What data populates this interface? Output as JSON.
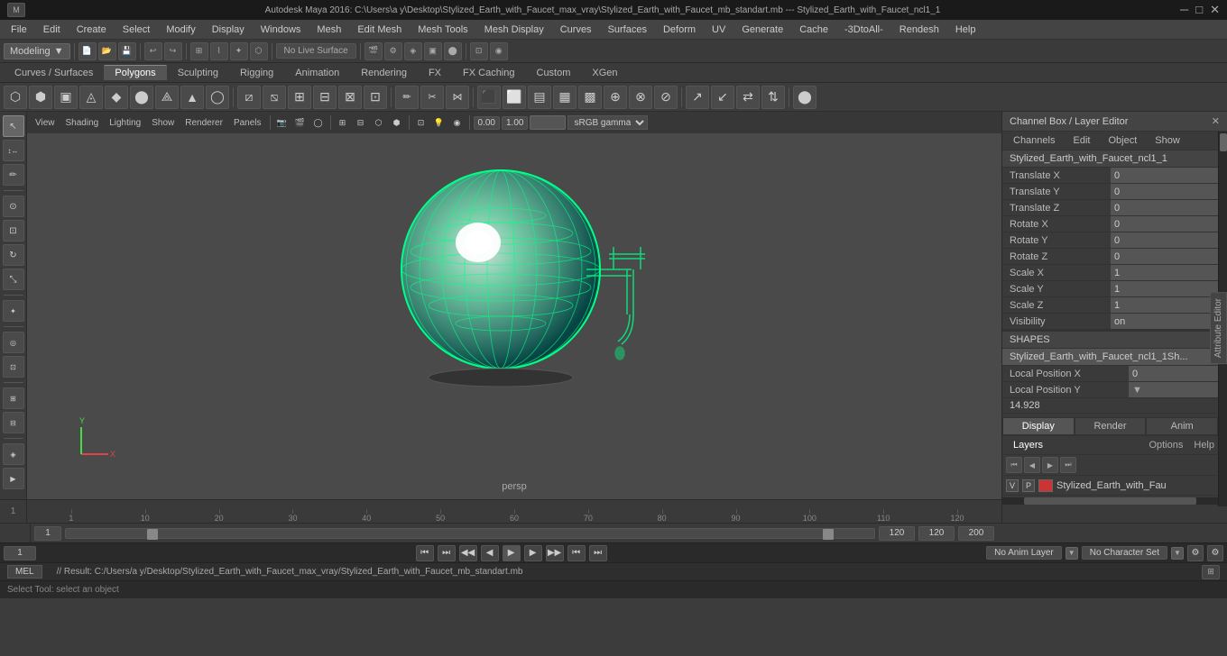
{
  "titlebar": {
    "title": "Autodesk Maya 2016: C:\\Users\\a y\\Desktop\\Stylized_Earth_with_Faucet_max_vray\\Stylized_Earth_with_Faucet_mb_standart.mb  ---  Stylized_Earth_with_Faucet_ncl1_1",
    "minimize": "─",
    "maximize": "□",
    "close": "✕"
  },
  "menubar": {
    "items": [
      "File",
      "Edit",
      "Create",
      "Select",
      "Modify",
      "Display",
      "Windows",
      "Mesh",
      "Edit Mesh",
      "Mesh Tools",
      "Mesh Display",
      "Curves",
      "Surfaces",
      "Deform",
      "UV",
      "Generate",
      "Cache",
      "-3DtoAll-",
      "Rendesh",
      "Help"
    ]
  },
  "workspace": {
    "selector": "Modeling",
    "no_live_surface": "No Live Surface"
  },
  "tabs": {
    "items": [
      "Curves / Surfaces",
      "Polygons",
      "Sculpting",
      "Rigging",
      "Animation",
      "Rendering",
      "FX",
      "FX Caching",
      "Custom",
      "XGen"
    ],
    "active": "Polygons"
  },
  "viewport": {
    "label": "persp",
    "toolbar_items": [
      "View",
      "Shading",
      "Lighting",
      "Show",
      "Renderer",
      "Panels"
    ]
  },
  "channel_box": {
    "header": "Channel Box / Layer Editor",
    "tabs": [
      "Channels",
      "Edit",
      "Object",
      "Show"
    ],
    "object_name": "Stylized_Earth_with_Faucet_ncl1_1",
    "attributes": [
      {
        "name": "Translate X",
        "value": "0"
      },
      {
        "name": "Translate Y",
        "value": "0"
      },
      {
        "name": "Translate Z",
        "value": "0"
      },
      {
        "name": "Rotate X",
        "value": "0"
      },
      {
        "name": "Rotate Y",
        "value": "0"
      },
      {
        "name": "Rotate Z",
        "value": "0"
      },
      {
        "name": "Scale X",
        "value": "1"
      },
      {
        "name": "Scale Y",
        "value": "1"
      },
      {
        "name": "Scale Z",
        "value": "1"
      },
      {
        "name": "Visibility",
        "value": "on"
      }
    ],
    "shapes_header": "SHAPES",
    "shapes_item": "Stylized_Earth_with_Faucet_ncl1_1Sh...",
    "shape_attributes": [
      {
        "name": "Local Position X",
        "value": "0"
      },
      {
        "name": "Local Position Y",
        "value": "14.928"
      }
    ]
  },
  "display_tabs": {
    "items": [
      "Display",
      "Render",
      "Anim"
    ],
    "active": "Display"
  },
  "layers": {
    "header": "Layers",
    "tabs": [
      "Layers",
      "Options",
      "Help"
    ],
    "active": "Layers",
    "toolbar_icons": [
      "<<",
      "<",
      ">",
      ">>"
    ],
    "items": [
      {
        "v": "V",
        "p": "P",
        "color": "#cc3333",
        "name": "Stylized_Earth_with_Fau"
      }
    ]
  },
  "timeline": {
    "ticks": [
      "1",
      "",
      "10",
      "",
      "20",
      "",
      "30",
      "",
      "40",
      "",
      "50",
      "",
      "60",
      "",
      "70",
      "",
      "80",
      "",
      "90",
      "",
      "100",
      "",
      "110",
      "",
      "120"
    ],
    "current_frame": "1",
    "start": "1",
    "end": "120",
    "range_start": "1",
    "range_end": "120",
    "fps": "200"
  },
  "playback": {
    "buttons": [
      "⏮",
      "⏭",
      "◀◀",
      "◀",
      "▶",
      "▶▶"
    ],
    "no_anim_layer": "No Anim Layer",
    "no_character_set": "No Character Set",
    "frame_input": "1"
  },
  "status_bar": {
    "mel_label": "MEL",
    "result": "// Result: C:/Users/a y/Desktop/Stylized_Earth_with_Faucet_max_vray/Stylized_Earth_with_Faucet_mb_standart.mb",
    "tool_label": "Select Tool: select an object"
  },
  "gamma": {
    "value0": "0.00",
    "value1": "1.00",
    "label": "sRGB gamma"
  },
  "vertical_tab": "Channel Box / Layer Editor",
  "attr_editor": "Attribute Editor"
}
